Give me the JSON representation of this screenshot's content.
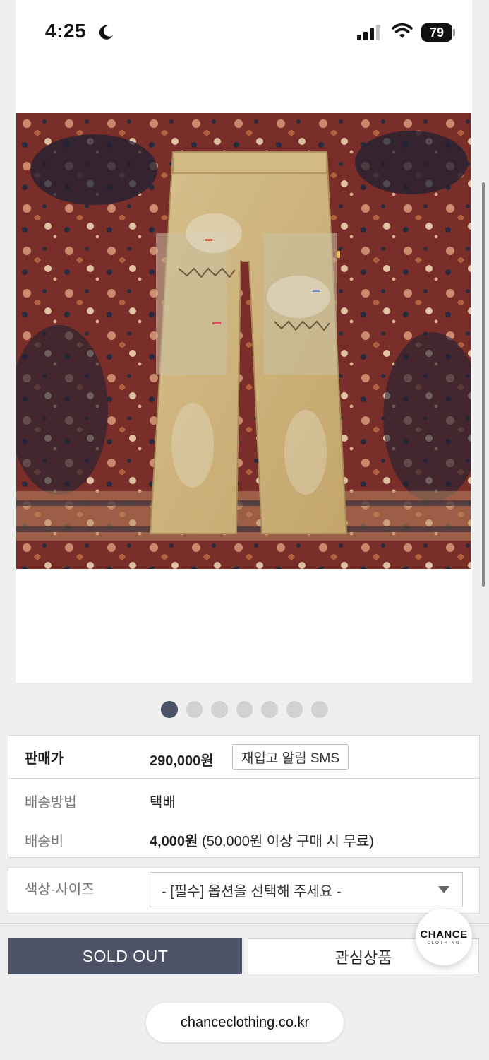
{
  "status_bar": {
    "time": "4:25",
    "battery": "79"
  },
  "product_image": {
    "description_icon": "carpenter-jeans-photo"
  },
  "carousel": {
    "total": 7,
    "active": 1
  },
  "price_section": {
    "label": "판매가",
    "price": "290,000원",
    "restock_button": "재입고 알림 SMS"
  },
  "shipping_section": {
    "method_label": "배송방법",
    "method_value": "택배",
    "fee_label": "배송비",
    "fee_value": "4,000원",
    "fee_note": "(50,000원 이상 구매 시 무료)"
  },
  "option_section": {
    "label": "색상-사이즈",
    "placeholder": "- [필수] 옵션을 선택해 주세요 -"
  },
  "actions": {
    "sold_out": "SOLD OUT",
    "wishlist": "관심상품"
  },
  "brand_badge": {
    "name": "CHANCE",
    "sub": "CLOTHING"
  },
  "browser": {
    "url": "chanceclothing.co.kr"
  },
  "colors": {
    "accent": "#4e5266",
    "background": "#efefef"
  }
}
